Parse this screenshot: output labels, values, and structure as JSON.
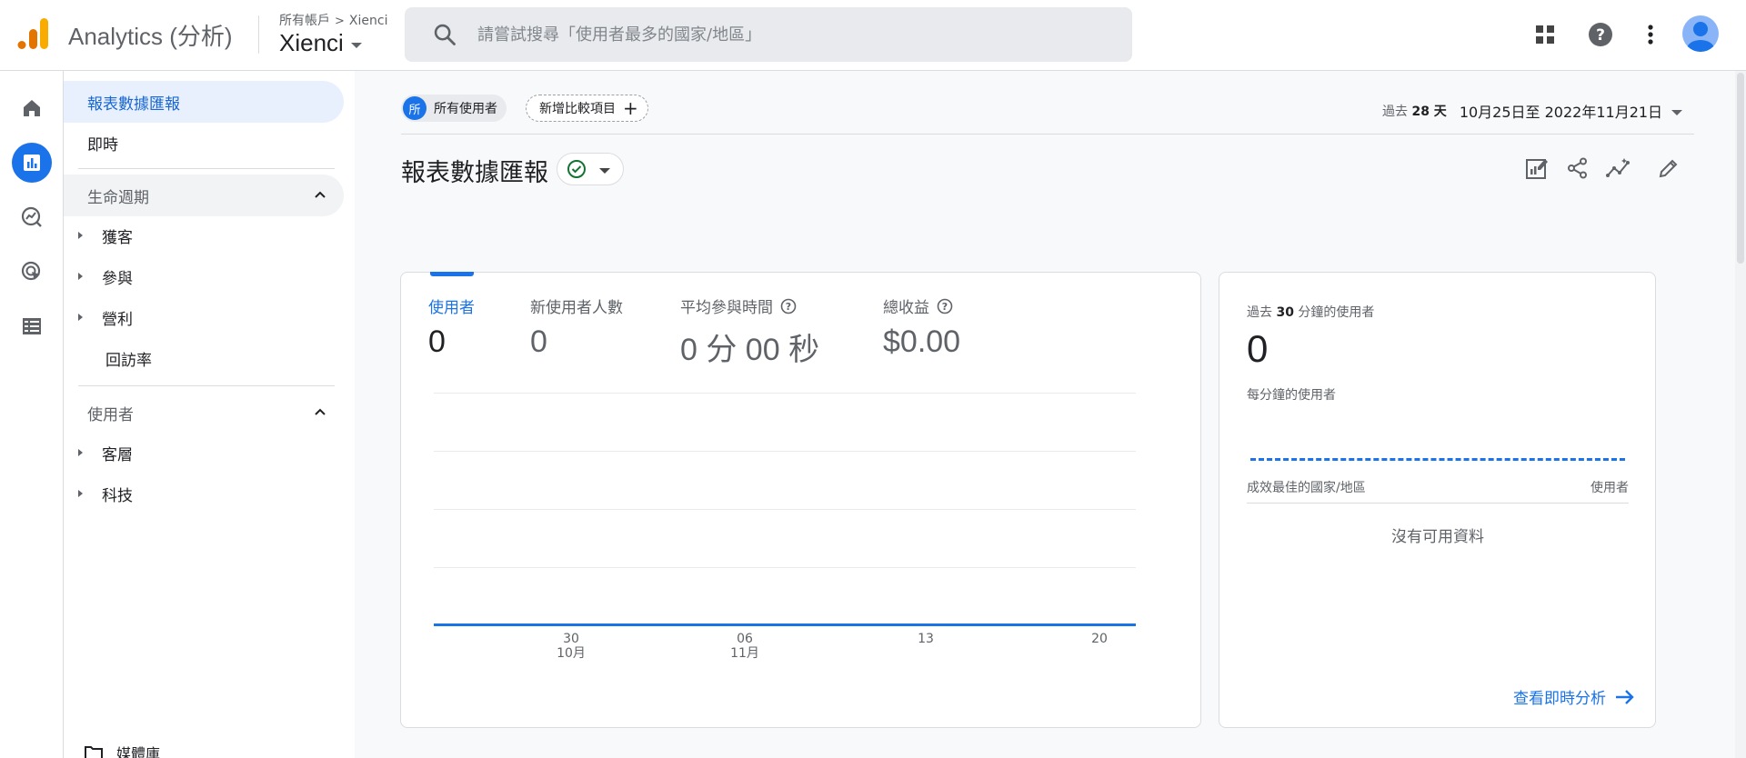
{
  "app": {
    "name": "Analytics (分析)"
  },
  "account": {
    "crumb_all": "所有帳戶",
    "crumb_name": "Xienci",
    "property": "Xienci"
  },
  "search": {
    "placeholder": "請嘗試搜尋「使用者最多的國家/地區」"
  },
  "colors": {
    "accent": "#1a73e8",
    "logo_orange": "#f9ab00",
    "logo_dark": "#e37400"
  },
  "icons": [
    "analytics-logo-icon",
    "search-icon",
    "apps-grid-icon",
    "help-icon",
    "more-vert-icon",
    "avatar-icon",
    "home-icon",
    "reports-icon",
    "explore-icon",
    "advertising-icon",
    "configure-icon",
    "insights-icon",
    "share-icon",
    "edit-report-icon",
    "pencil-icon",
    "check-circle-icon",
    "arrow-right-icon",
    "folder-icon"
  ],
  "sidebar": {
    "overview": "報表數據匯報",
    "realtime": "即時",
    "lifecycle": {
      "label": "生命週期",
      "items": [
        "獲客",
        "參與",
        "營利"
      ],
      "retention": "回訪率"
    },
    "user": {
      "label": "使用者",
      "items": [
        "客層",
        "科技"
      ]
    },
    "library": "媒體庫"
  },
  "comparison": {
    "all_users_letter": "所",
    "all_users": "所有使用者",
    "add": "新增比較項目"
  },
  "date_range": {
    "prefix": "過去",
    "days": "28 天",
    "range": "10月25日至 2022年11月21日"
  },
  "page": {
    "title": "報表數據匯報"
  },
  "metrics": [
    {
      "label": "使用者",
      "value": "0"
    },
    {
      "label": "新使用者人數",
      "value": "0"
    },
    {
      "label": "平均參與時間",
      "value": "0 分 00 秒"
    },
    {
      "label": "總收益",
      "value": "$0.00"
    }
  ],
  "chart": {
    "x_ticks": [
      {
        "day": "30",
        "month": "10月"
      },
      {
        "day": "06",
        "month": "11月"
      },
      {
        "day": "13",
        "month": ""
      },
      {
        "day": "20",
        "month": ""
      }
    ]
  },
  "realtime_card": {
    "label_prefix": "過去",
    "label_bold": "30",
    "label_suffix": "分鐘的使用者",
    "value": "0",
    "per_minute": "每分鐘的使用者",
    "col_country": "成效最佳的國家/地區",
    "col_users": "使用者",
    "no_data": "沒有可用資料",
    "link": "查看即時分析"
  }
}
